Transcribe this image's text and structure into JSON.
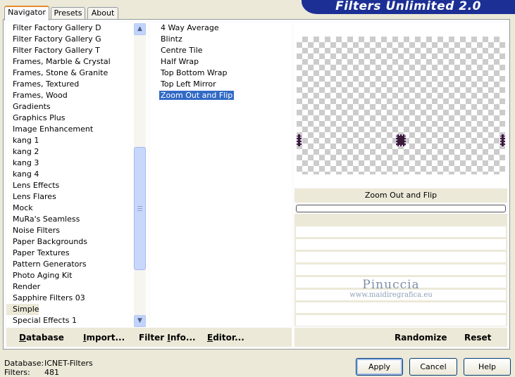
{
  "banner": {
    "title": "Filters Unlimited 2.0"
  },
  "tabs": [
    "Navigator",
    "Presets",
    "About"
  ],
  "categories": [
    "Filter Factory Gallery D",
    "Filter Factory Gallery G",
    "Filter Factory Gallery T",
    "Frames, Marble & Crystal",
    "Frames, Stone & Granite",
    "Frames, Textured",
    "Frames, Wood",
    "Gradients",
    "Graphics Plus",
    "Image Enhancement",
    "kang 1",
    "kang 2",
    "kang 3",
    "kang 4",
    "Lens Effects",
    "Lens Flares",
    "Mock",
    "MuRa's Seamless",
    "Noise Filters",
    "Paper Backgrounds",
    "Paper Textures",
    "Pattern Generators",
    "Photo Aging Kit",
    "Render",
    "Sapphire Filters 03",
    "Simple",
    "Special Effects 1"
  ],
  "selected_category": "Simple",
  "filters": [
    "4 Way Average",
    "Blintz",
    "Centre Tile",
    "Half Wrap",
    "Top Bottom Wrap",
    "Top Left Mirror",
    "Zoom Out and Flip"
  ],
  "selected_filter": "Zoom Out and Flip",
  "preview": {
    "filter_name": "Zoom Out and Flip"
  },
  "watermark": {
    "line1": "Pinuccia",
    "line2": "www.maidiregrafica.eu"
  },
  "toolbar": {
    "database": {
      "underlined": "D",
      "rest": "atabase"
    },
    "import": {
      "underlined": "I",
      "rest": "mport..."
    },
    "filter_info": {
      "before": "Filter ",
      "underlined": "I",
      "after": "nfo..."
    },
    "editor": {
      "underlined": "E",
      "rest": "ditor..."
    },
    "randomize": "Randomize",
    "reset": "Reset"
  },
  "status": {
    "database_label": "Database:",
    "database_value": "ICNET-Filters",
    "filters_label": "Filters:",
    "filters_value": "481"
  },
  "buttons": {
    "apply": "Apply",
    "cancel": "Cancel",
    "help": "Help"
  },
  "colors": {
    "banner": "#1b2f95",
    "selection": "#316ac5",
    "dialog": "#ece9d8"
  }
}
